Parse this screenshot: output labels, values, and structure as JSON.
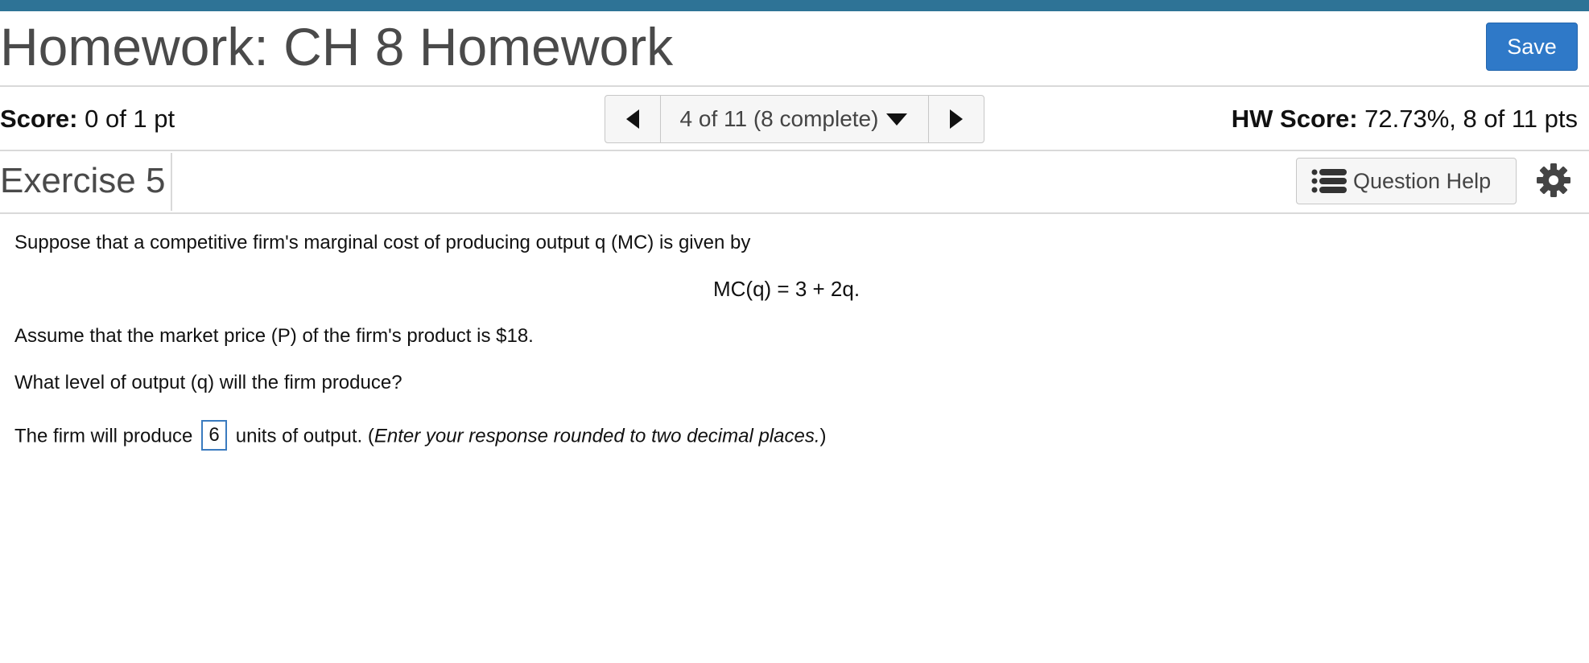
{
  "header": {
    "title": "Homework: CH 8 Homework",
    "save_label": "Save"
  },
  "score_bar": {
    "score_label": "Score:",
    "score_value": "0 of 1 pt",
    "nav_selector_label": "4 of 11 (8 complete)",
    "hw_score_label": "HW Score:",
    "hw_score_value": "72.73%, 8 of 11 pts"
  },
  "exercise_bar": {
    "title": "Exercise 5",
    "help_label": "Question Help"
  },
  "question": {
    "intro": "Suppose that a competitive firm's marginal cost of producing output q (MC) is given by",
    "formula": "MC(q) = 3 + 2q.",
    "assumption": "Assume that the market price (P) of the firm's product is $18.",
    "prompt": "What level of output (q) will the firm produce?",
    "answer_prefix": "The firm will produce",
    "answer_value": "6",
    "answer_suffix": "units of output. (",
    "answer_hint": "Enter your response rounded to two decimal places.",
    "answer_close": ")"
  },
  "icons": {
    "prev": "triangle-left-icon",
    "next": "triangle-right-icon",
    "dropdown": "caret-down-icon",
    "help": "list-icon",
    "settings": "gear-icon"
  },
  "colors": {
    "accent_bar": "#2e7396",
    "save_button": "#2f79c8",
    "answer_border": "#3a7bbf"
  }
}
